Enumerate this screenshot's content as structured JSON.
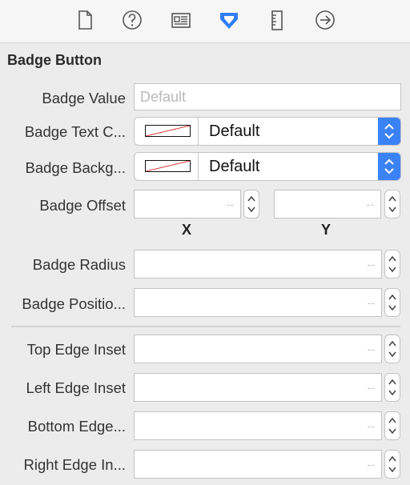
{
  "toolbar": {
    "icons": [
      "file-icon",
      "help-icon",
      "identity-icon",
      "attributes-icon",
      "size-icon",
      "connections-icon"
    ],
    "active_icon": "attributes-icon",
    "accent": "#2f7df6"
  },
  "section": {
    "title": "Badge Button"
  },
  "fields": {
    "badge_value": {
      "label": "Badge Value",
      "placeholder": "Default",
      "value": ""
    },
    "badge_text_color": {
      "label": "Badge Text C...",
      "value": "Default"
    },
    "badge_background": {
      "label": "Badge Backg...",
      "value": "Default"
    },
    "badge_offset": {
      "label": "Badge Offset",
      "x_value": "--",
      "y_value": "--",
      "x_label": "X",
      "y_label": "Y"
    },
    "badge_radius": {
      "label": "Badge Radius",
      "value": "--"
    },
    "badge_position": {
      "label": "Badge Positio...",
      "value": "--"
    },
    "top_edge_inset": {
      "label": "Top Edge Inset",
      "value": "--"
    },
    "left_edge_inset": {
      "label": "Left Edge Inset",
      "value": "--"
    },
    "bottom_edge": {
      "label": "Bottom Edge...",
      "value": "--"
    },
    "right_edge": {
      "label": "Right Edge In...",
      "value": "--"
    }
  }
}
